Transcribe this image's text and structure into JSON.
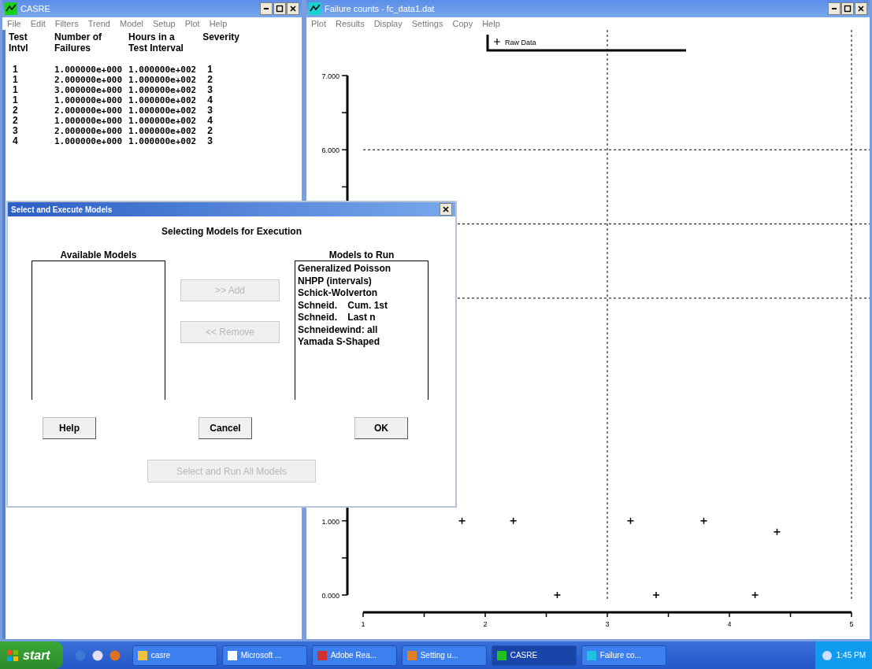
{
  "casre_window": {
    "title": "CASRE",
    "menu": [
      "File",
      "Edit",
      "Filters",
      "Trend",
      "Model",
      "Setup",
      "Plot",
      "Help"
    ],
    "table": {
      "header_rows": [
        [
          "Test",
          "Number of",
          "Hours in a",
          "Severity"
        ],
        [
          "Intvl",
          "Failures",
          "Test Interval"
        ]
      ],
      "rows": [
        [
          "1",
          "1.000000e+000",
          "1.000000e+002",
          "1"
        ],
        [
          "1",
          "2.000000e+000",
          "1.000000e+002",
          "2"
        ],
        [
          "1",
          "3.000000e+000",
          "1.000000e+002",
          "3"
        ],
        [
          "1",
          "1.000000e+000",
          "1.000000e+002",
          "4"
        ],
        [
          "2",
          "2.000000e+000",
          "1.000000e+002",
          "3"
        ],
        [
          "2",
          "1.000000e+000",
          "1.000000e+002",
          "4"
        ],
        [
          "3",
          "2.000000e+000",
          "1.000000e+002",
          "2"
        ],
        [
          "4",
          "1.000000e+000",
          "1.000000e+002",
          "3"
        ]
      ]
    }
  },
  "plot_window": {
    "title": "Failure counts - fc_data1.dat",
    "menu": [
      "Plot",
      "Results",
      "Display",
      "Settings",
      "Copy",
      "Help"
    ],
    "chart_data": {
      "type": "scatter",
      "x": [
        1.81,
        2.23,
        2.59,
        3.19,
        3.4,
        3.79,
        4.21,
        4.39
      ],
      "series": [
        {
          "name": "Raw Data",
          "color": "#000000",
          "values": [
            1,
            1,
            0,
            1,
            0,
            1,
            0,
            0.85
          ]
        }
      ],
      "xlim": [
        1,
        5
      ],
      "ylim": [
        0,
        7
      ],
      "xticks": [
        1,
        2,
        3,
        4,
        5
      ],
      "yticks": [
        {
          "value": 0,
          "label": "0.000"
        },
        {
          "value": 1,
          "label": "1.000"
        },
        {
          "value": 6,
          "label": "6.000"
        },
        {
          "value": 7,
          "label": "7.000"
        }
      ]
    }
  },
  "dialog": {
    "title": "Select and Execute Models",
    "heading": "Selecting Models for Execution",
    "available": {
      "label": "Available Models"
    },
    "to_run": {
      "label": "Models to Run",
      "items": [
        "Generalized Poisson",
        "NHPP (intervals)",
        "Schick-Wolverton",
        "Schneid.    Cum. 1st",
        "Schneid.    Last n",
        "Schneidewind: all",
        "Yamada S-Shaped"
      ]
    },
    "buttons": [
      {
        "label": ">> Add",
        "kind": "move",
        "disabled": true
      },
      {
        "label": "<< Remove",
        "kind": "move",
        "disabled": true
      },
      {
        "label": "Help",
        "kind": "bottom",
        "disabled": false
      },
      {
        "label": "Cancel",
        "kind": "bottom",
        "disabled": false
      },
      {
        "label": "OK",
        "kind": "bottom",
        "disabled": false
      },
      {
        "label": "Select and Run All Models",
        "kind": "all",
        "disabled": true
      }
    ]
  },
  "taskbar": {
    "start": "start",
    "items": [
      {
        "label": "casre",
        "selected": false
      },
      {
        "label": "Microsoft ...",
        "selected": false
      },
      {
        "label": "Adobe Rea...",
        "selected": false
      },
      {
        "label": "Setting u...",
        "selected": false
      },
      {
        "label": "CASRE",
        "selected": true
      },
      {
        "label": "Failure co...",
        "selected": false
      }
    ],
    "clock": "1:45 PM"
  }
}
